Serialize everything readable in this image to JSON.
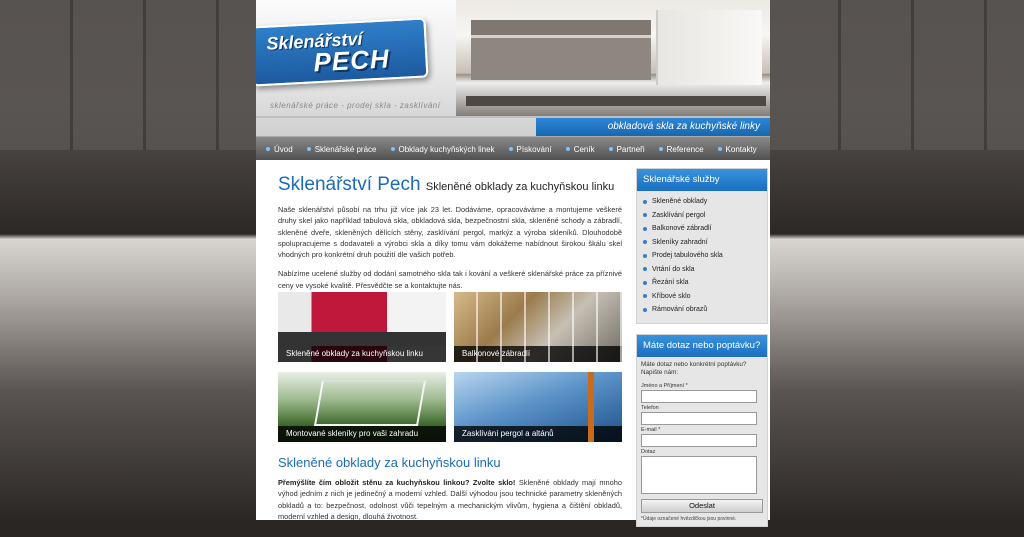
{
  "header": {
    "logo_line1": "Sklenářství",
    "logo_line2": "PECH",
    "tagline": "sklenářské práce - prodej skla - zasklívání",
    "ribbon": "obkladová skla za kuchyňské linky"
  },
  "nav": {
    "items": [
      {
        "label": "Úvod"
      },
      {
        "label": "Sklenářské práce"
      },
      {
        "label": "Obklady kuchyňských linek"
      },
      {
        "label": "Pískování"
      },
      {
        "label": "Ceník"
      },
      {
        "label": "Partneři"
      },
      {
        "label": "Reference"
      },
      {
        "label": "Kontakty"
      }
    ]
  },
  "main": {
    "title": "Sklenářství Pech",
    "subtitle": "Skleněné obklady za kuchyňskou linku",
    "para1": "Naše sklenářství působí na trhu již více jak 23 let. Dodáváme, opracováváme a montujeme veškeré druhy skel jako například tabulová skla, obkladová skla, bezpečnostní skla, skleněné schody a zábradlí, skleněné dveře, skleněných dělících stěny, zasklívání pergol, markýz a výroba skleníků. Dlouhodobě spolupracujeme s dodavateli a výrobci skla a díky tomu vám dokážeme nabídnout širokou škálu skel vhodných pro konkrétní druh použití dle vašich potřeb.",
    "para2": "Nabízíme ucelené služby od dodání samotného skla tak i kování a veškeré sklenářské práce za příznivé ceny ve vysoké kvalitě. Přesvědčte se a kontaktujte nás.",
    "thumbs": [
      {
        "caption": "Skleněné obklady za kuchyňskou linku"
      },
      {
        "caption": "Balkonové zábradlí"
      },
      {
        "caption": "Montované skleníky pro vaši zahradu"
      },
      {
        "caption": "Zasklívání pergol a altánů"
      }
    ],
    "section_title": "Skleněné obklady za kuchyňskou linku",
    "section_lead": "Přemýšlíte čím obložit stěnu za kuchyňskou linkou? Zvolte sklo!",
    "section_text": " Skleněné obklady mají mnoho výhod jedním z nich je jedinečný a moderní vzhled. Další výhodou jsou technické parametry skleněných obkladů a to: bezpečnost, odolnost vůči tepelným a mechanickým vlivům, hygiena a čištění obkladů, moderní vzhled a design, dlouhá životnost."
  },
  "sidebar": {
    "services_title": "Sklenářské služby",
    "services": [
      {
        "label": "Skleněné obklady"
      },
      {
        "label": "Zasklívání pergol"
      },
      {
        "label": "Balkonové zábradlí"
      },
      {
        "label": "Skleníky zahradní"
      },
      {
        "label": "Prodej tabulového skla"
      },
      {
        "label": "Vrtání do skla"
      },
      {
        "label": "Řezání skla"
      },
      {
        "label": "Kříbové sklo"
      },
      {
        "label": "Rámování obrazů"
      }
    ],
    "form": {
      "title": "Máte dotaz nebo poptávku?",
      "intro": "Máte dotaz nebo konkrétní poptávku? Napište nám:",
      "name_label": "Jméno a Příjmení *",
      "phone_label": "Telefon",
      "email_label": "E-mail *",
      "question_label": "Dotaz",
      "submit": "Odeslat",
      "note": "*Údaje označené hvězdičkou jsou povinné."
    }
  },
  "colors": {
    "accent": "#1b6bb6",
    "nav_bg": "#5a5a5a",
    "sidebar_head": "#2a80d0"
  }
}
